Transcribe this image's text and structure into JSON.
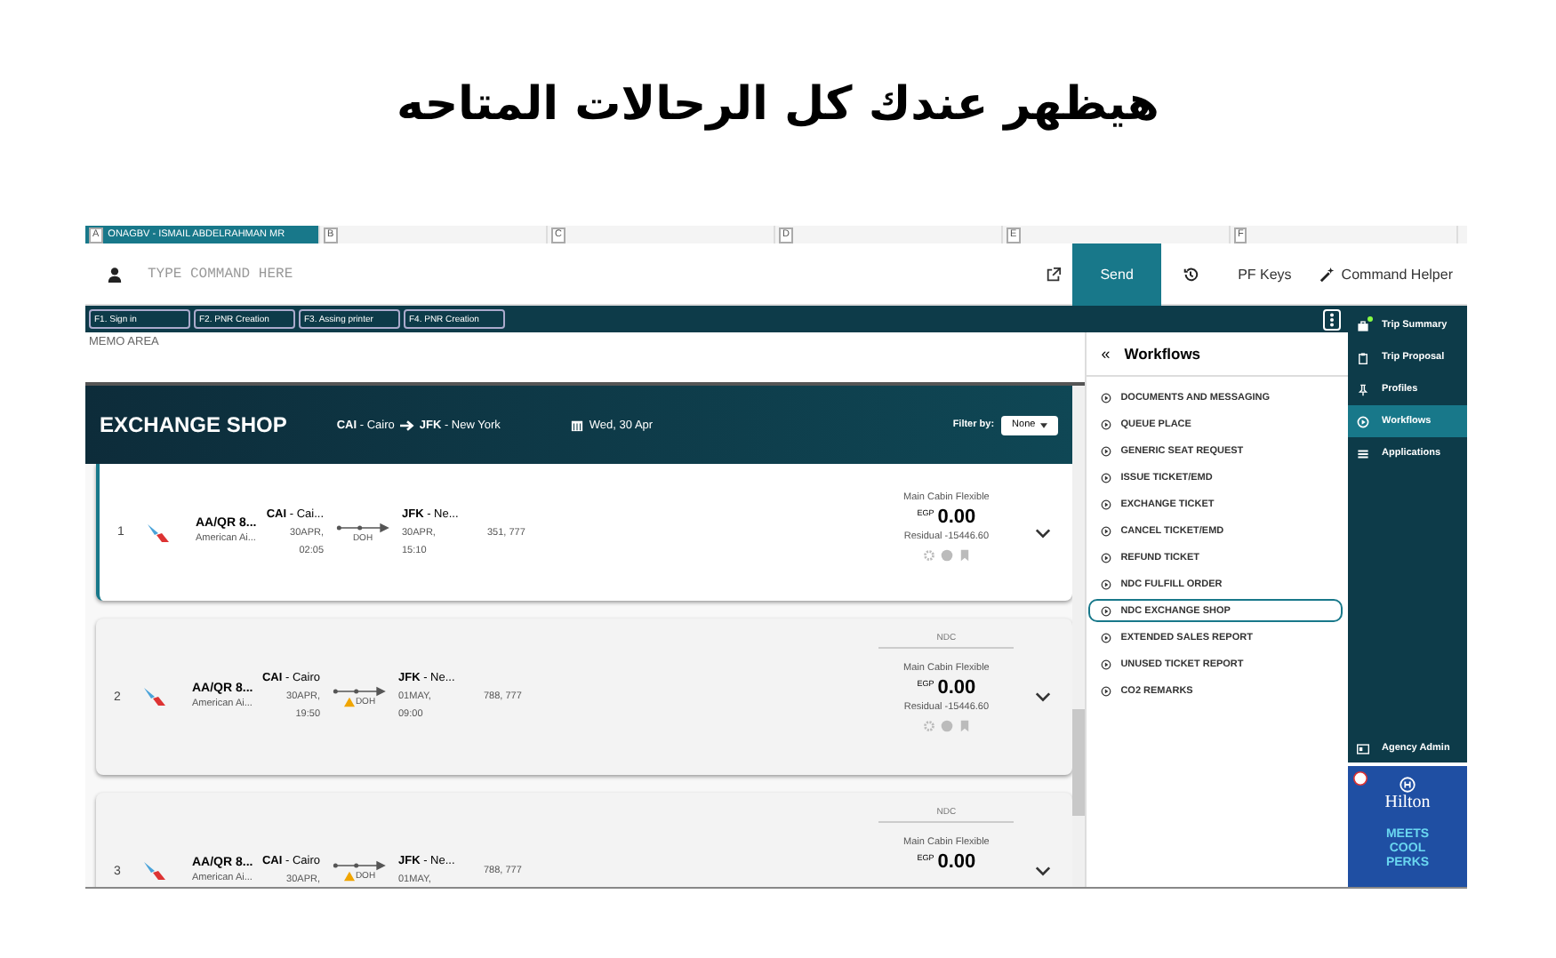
{
  "title": "هيظهر عندك كل الرحالات المتاحه",
  "session_tabs": [
    {
      "letter": "A",
      "label": "ONAGBV - ISMAIL ABDELRAHMAN MR",
      "selected": true
    },
    {
      "letter": "B",
      "selected": false
    },
    {
      "letter": "C",
      "selected": false
    },
    {
      "letter": "D",
      "selected": false
    },
    {
      "letter": "E",
      "selected": false
    },
    {
      "letter": "F",
      "selected": false
    }
  ],
  "command": {
    "placeholder": "TYPE COMMAND HERE",
    "send": "Send",
    "pf_keys": "PF Keys",
    "helper": "Command Helper"
  },
  "function_keys": [
    "F1. Sign in",
    "F2. PNR Creation",
    "F3. Assing printer",
    "F4. PNR Creation"
  ],
  "memo": {
    "placeholder": "MEMO AREA"
  },
  "exchange_shop": {
    "title": "EXCHANGE SHOP",
    "origin_code": "CAI",
    "origin_city": "- Cairo",
    "dest_code": "JFK",
    "dest_city": "- New York",
    "date": "Wed, 30 Apr",
    "filter_label": "Filter by:",
    "filter_value": "None"
  },
  "flights": [
    {
      "index": "1",
      "selected": true,
      "airline": "AA/QR 8...",
      "airline_name": "American Ai...",
      "origin": "CAI",
      "origin_city": "- Cai...",
      "dep_date": "30APR,",
      "dep_time": "02:05",
      "stop": "DOH",
      "stop_warning": false,
      "dest": "JFK",
      "dest_city": "- Ne...",
      "arr_date": "30APR,",
      "arr_time": "15:10",
      "aircraft": "351, 777",
      "fare_name": "Main Cabin Flexible",
      "currency": "EGP",
      "amount": "0.00",
      "residual": "Residual -15446.60",
      "actions": true
    },
    {
      "index": "2",
      "selected": false,
      "airline": "AA/QR 8...",
      "airline_name": "American Ai...",
      "origin": "CAI",
      "origin_city": "- Cairo",
      "dep_date": "30APR,",
      "dep_time": "19:50",
      "stop": "DOH",
      "stop_warning": true,
      "dest": "JFK",
      "dest_city": "- Ne...",
      "arr_date": "01MAY,",
      "arr_time": "09:00",
      "aircraft": "788, 777",
      "source": "NDC",
      "fare_name": "Main Cabin Flexible",
      "currency": "EGP",
      "amount": "0.00",
      "residual": "Residual -15446.60",
      "actions": true
    },
    {
      "index": "3",
      "selected": false,
      "airline": "AA/QR 8...",
      "airline_name": "American Ai...",
      "origin": "CAI",
      "origin_city": "- Cairo",
      "dep_date": "30APR,",
      "stop": "DOH",
      "stop_warning": true,
      "dest": "JFK",
      "dest_city": "- Ne...",
      "arr_date": "01MAY,",
      "aircraft": "788, 777",
      "source": "NDC",
      "fare_name": "Main Cabin Flexible",
      "currency": "EGP",
      "amount": "0.00",
      "actions": false
    }
  ],
  "workflows": {
    "collapse": "«",
    "title": "Workflows",
    "items": [
      {
        "label": "DOCUMENTS AND MESSAGING",
        "selected": false
      },
      {
        "label": "QUEUE PLACE",
        "selected": false
      },
      {
        "label": "GENERIC SEAT REQUEST",
        "selected": false
      },
      {
        "label": "ISSUE TICKET/EMD",
        "selected": false
      },
      {
        "label": "EXCHANGE TICKET",
        "selected": false
      },
      {
        "label": "CANCEL TICKET/EMD",
        "selected": false
      },
      {
        "label": "REFUND TICKET",
        "selected": false
      },
      {
        "label": "NDC FULFILL ORDER",
        "selected": false
      },
      {
        "label": "NDC EXCHANGE SHOP",
        "selected": true
      },
      {
        "label": "EXTENDED SALES REPORT",
        "selected": false
      },
      {
        "label": "UNUSED TICKET REPORT",
        "selected": false
      },
      {
        "label": "CO2 REMARKS",
        "selected": false
      }
    ]
  },
  "sidebar": {
    "items": [
      {
        "kind": "briefcase",
        "label": "Trip Summary",
        "selected": false,
        "notification": true
      },
      {
        "kind": "clipboard",
        "label": "Trip Proposal",
        "selected": false,
        "notification": false
      },
      {
        "kind": "pin",
        "label": "Profiles",
        "selected": false,
        "notification": false
      },
      {
        "kind": "play",
        "label": "Workflows",
        "selected": true,
        "notification": false
      },
      {
        "kind": "list",
        "label": "Applications",
        "selected": false,
        "notification": false
      }
    ],
    "footer": "Agency Admin"
  },
  "ad": {
    "brand": "Hilton",
    "tagline": "MEETS COOL PERKS"
  }
}
